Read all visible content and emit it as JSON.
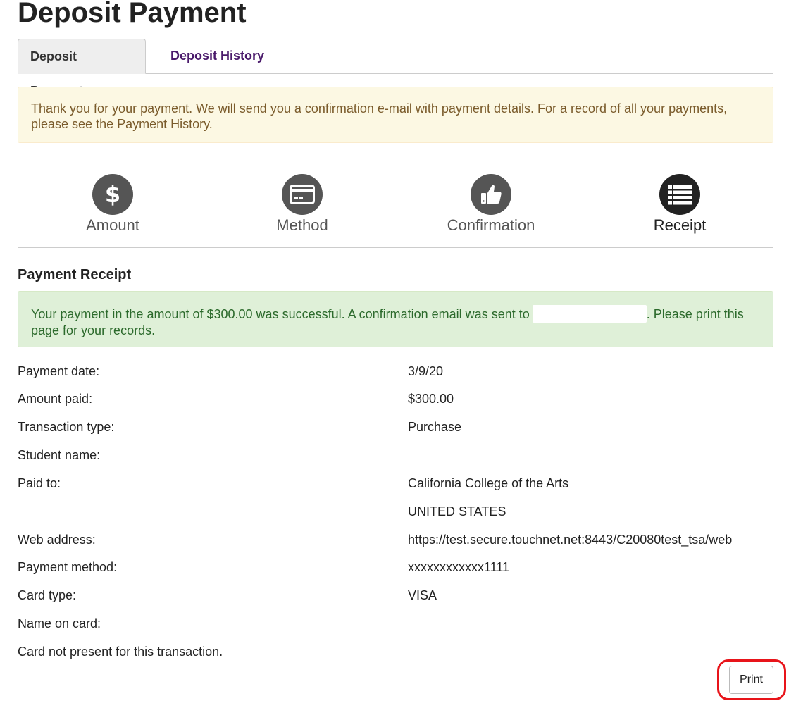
{
  "page": {
    "title": "Deposit Payment"
  },
  "tabs": [
    {
      "label": "Deposit Payment",
      "active": true
    },
    {
      "label": "Deposit History",
      "active": false
    }
  ],
  "notice": {
    "text": "Thank you for your payment. We will send you a confirmation e-mail with payment details. For a record of all your payments, please see the Payment History."
  },
  "steps": [
    {
      "label": "Amount",
      "icon": "dollar-icon"
    },
    {
      "label": "Method",
      "icon": "credit-card-icon"
    },
    {
      "label": "Confirmation",
      "icon": "thumbs-up-icon"
    },
    {
      "label": "Receipt",
      "icon": "list-icon",
      "current": true
    }
  ],
  "receipt": {
    "heading": "Payment Receipt",
    "success_before": "Your payment in the amount of $300.00 was successful.  A confirmation email was sent to",
    "success_after": ".  Please print this page for your records.",
    "rows": [
      {
        "label": "Payment date:",
        "value": "3/9/20"
      },
      {
        "label": "Amount paid:",
        "value": "$300.00"
      },
      {
        "label": "Transaction type:",
        "value": "Purchase"
      },
      {
        "label": "Student name:",
        "value": ""
      },
      {
        "label": "Paid to:",
        "value": "California College of the Arts"
      },
      {
        "label": "",
        "value": "UNITED STATES"
      },
      {
        "label": "Web address:",
        "value": "https://test.secure.touchnet.net:8443/C20080test_tsa/web"
      },
      {
        "label": "Payment method:",
        "value": "xxxxxxxxxxxx1111"
      },
      {
        "label": "Card type:",
        "value": "VISA"
      },
      {
        "label": "Name on card:",
        "value": ""
      },
      {
        "label": "Card not present for this transaction.",
        "value": ""
      }
    ],
    "print_label": "Print"
  },
  "colors": {
    "tab_link": "#4a1a6b",
    "warning_bg": "#fcf8e3",
    "warning_text": "#7a5b2b",
    "success_bg": "#dff0d8",
    "success_text": "#2c6a2c",
    "step_circle": "#555555",
    "step_current": "#222222",
    "highlight": "#e8141a"
  }
}
